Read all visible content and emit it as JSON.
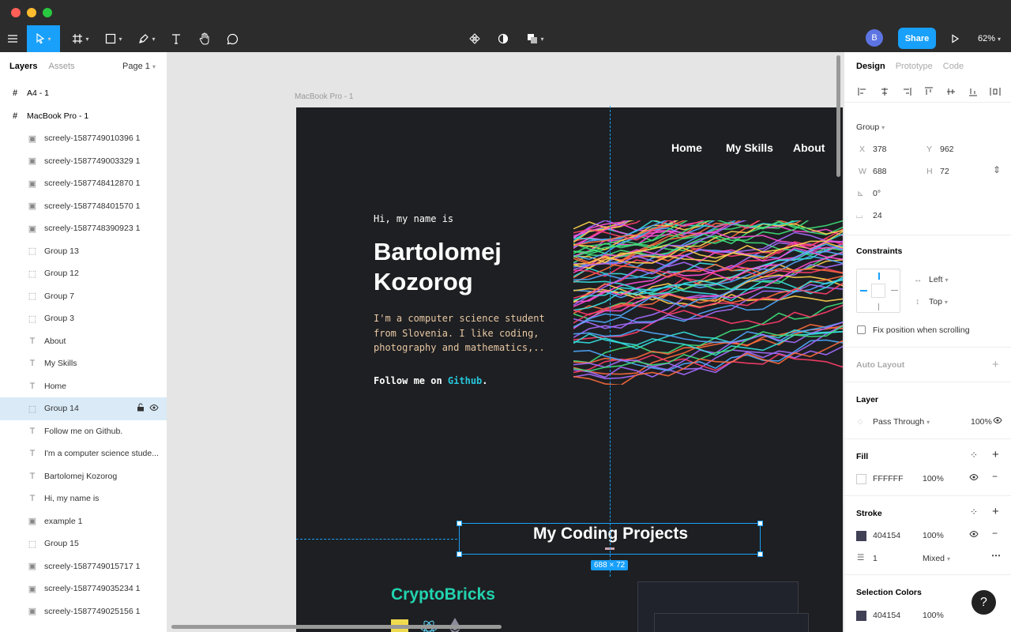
{
  "toolbar": {
    "share_label": "Share",
    "avatar_initial": "B",
    "zoom_level": "62%"
  },
  "left_panel": {
    "tabs": [
      "Layers",
      "Assets"
    ],
    "page_selector": "Page 1",
    "layers": [
      {
        "name": "A4 - 1",
        "icon": "frame-icon",
        "indent": 0
      },
      {
        "name": "MacBook Pro - 1",
        "icon": "frame-icon",
        "indent": 0
      },
      {
        "name": "screely-1587749010396 1",
        "icon": "image-icon",
        "indent": 1
      },
      {
        "name": "screely-1587749003329 1",
        "icon": "image-icon",
        "indent": 1
      },
      {
        "name": "screely-1587748412870 1",
        "icon": "image-icon",
        "indent": 1
      },
      {
        "name": "screely-1587748401570 1",
        "icon": "image-icon",
        "indent": 1
      },
      {
        "name": "screely-1587748390923 1",
        "icon": "image-icon",
        "indent": 1
      },
      {
        "name": "Group 13",
        "icon": "group-icon",
        "indent": 1
      },
      {
        "name": "Group 12",
        "icon": "group-icon",
        "indent": 1
      },
      {
        "name": "Group 7",
        "icon": "group-icon",
        "indent": 1
      },
      {
        "name": "Group 3",
        "icon": "group-icon",
        "indent": 1
      },
      {
        "name": "About",
        "icon": "text-icon",
        "indent": 1
      },
      {
        "name": "My Skills",
        "icon": "text-icon",
        "indent": 1
      },
      {
        "name": "Home",
        "icon": "text-icon",
        "indent": 1
      },
      {
        "name": "Group 14",
        "icon": "group-icon",
        "indent": 1,
        "selected": true
      },
      {
        "name": "Follow me on Github.",
        "icon": "text-icon",
        "indent": 1
      },
      {
        "name": "I'm a computer science stude...",
        "icon": "text-icon",
        "indent": 1
      },
      {
        "name": "Bartolomej Kozorog",
        "icon": "text-icon",
        "indent": 1
      },
      {
        "name": "Hi, my name is",
        "icon": "text-icon",
        "indent": 1
      },
      {
        "name": "example 1",
        "icon": "image-icon",
        "indent": 1
      },
      {
        "name": "Group 15",
        "icon": "group-icon",
        "indent": 1
      },
      {
        "name": "screely-1587749015717 1",
        "icon": "image-icon",
        "indent": 1
      },
      {
        "name": "screely-1587749035234 1",
        "icon": "image-icon",
        "indent": 1
      },
      {
        "name": "screely-1587749025156 1",
        "icon": "image-icon",
        "indent": 1
      }
    ]
  },
  "canvas": {
    "frame_label": "MacBook Pro - 1",
    "nav": [
      "Home",
      "My Skills",
      "About"
    ],
    "greeting": "Hi, my name is",
    "name": "Bartolomej Kozorog",
    "description": "I'm a computer science student from Slovenia. I like coding, photography and mathematics,..",
    "follow_prefix": "Follow me on ",
    "follow_link": "Github",
    "follow_suffix": ".",
    "projects_heading": "My Coding Projects",
    "project_name": "CryptoBricks",
    "selection_size": "688 × 72"
  },
  "right_panel": {
    "tabs": [
      "Design",
      "Prototype",
      "Code"
    ],
    "group_label": "Group",
    "x_label": "X",
    "x_value": "378",
    "y_label": "Y",
    "y_value": "962",
    "w_label": "W",
    "w_value": "688",
    "h_label": "H",
    "h_value": "72",
    "rotation": "0°",
    "corner_radius": "24",
    "constraints_title": "Constraints",
    "constraint_h": "Left",
    "constraint_v": "Top",
    "fix_position_label": "Fix position when scrolling",
    "auto_layout_title": "Auto Layout",
    "layer_title": "Layer",
    "blend_mode": "Pass Through",
    "layer_opacity": "100%",
    "fill_title": "Fill",
    "fill_hex": "FFFFFF",
    "fill_opacity": "100%",
    "stroke_title": "Stroke",
    "stroke_hex": "404154",
    "stroke_opacity": "100%",
    "stroke_weight": "1",
    "stroke_mode": "Mixed",
    "selection_colors_title": "Selection Colors",
    "sel_color_hex": "404154",
    "sel_color_opacity": "100%",
    "help_label": "?"
  },
  "colors": {
    "accent": "#18a0fb",
    "toolbar_bg": "#2c2c2c",
    "frame_bg": "#1e1f22",
    "stroke_swatch": "#404154",
    "link": "#26c6da",
    "project_title": "#22d3b0"
  }
}
